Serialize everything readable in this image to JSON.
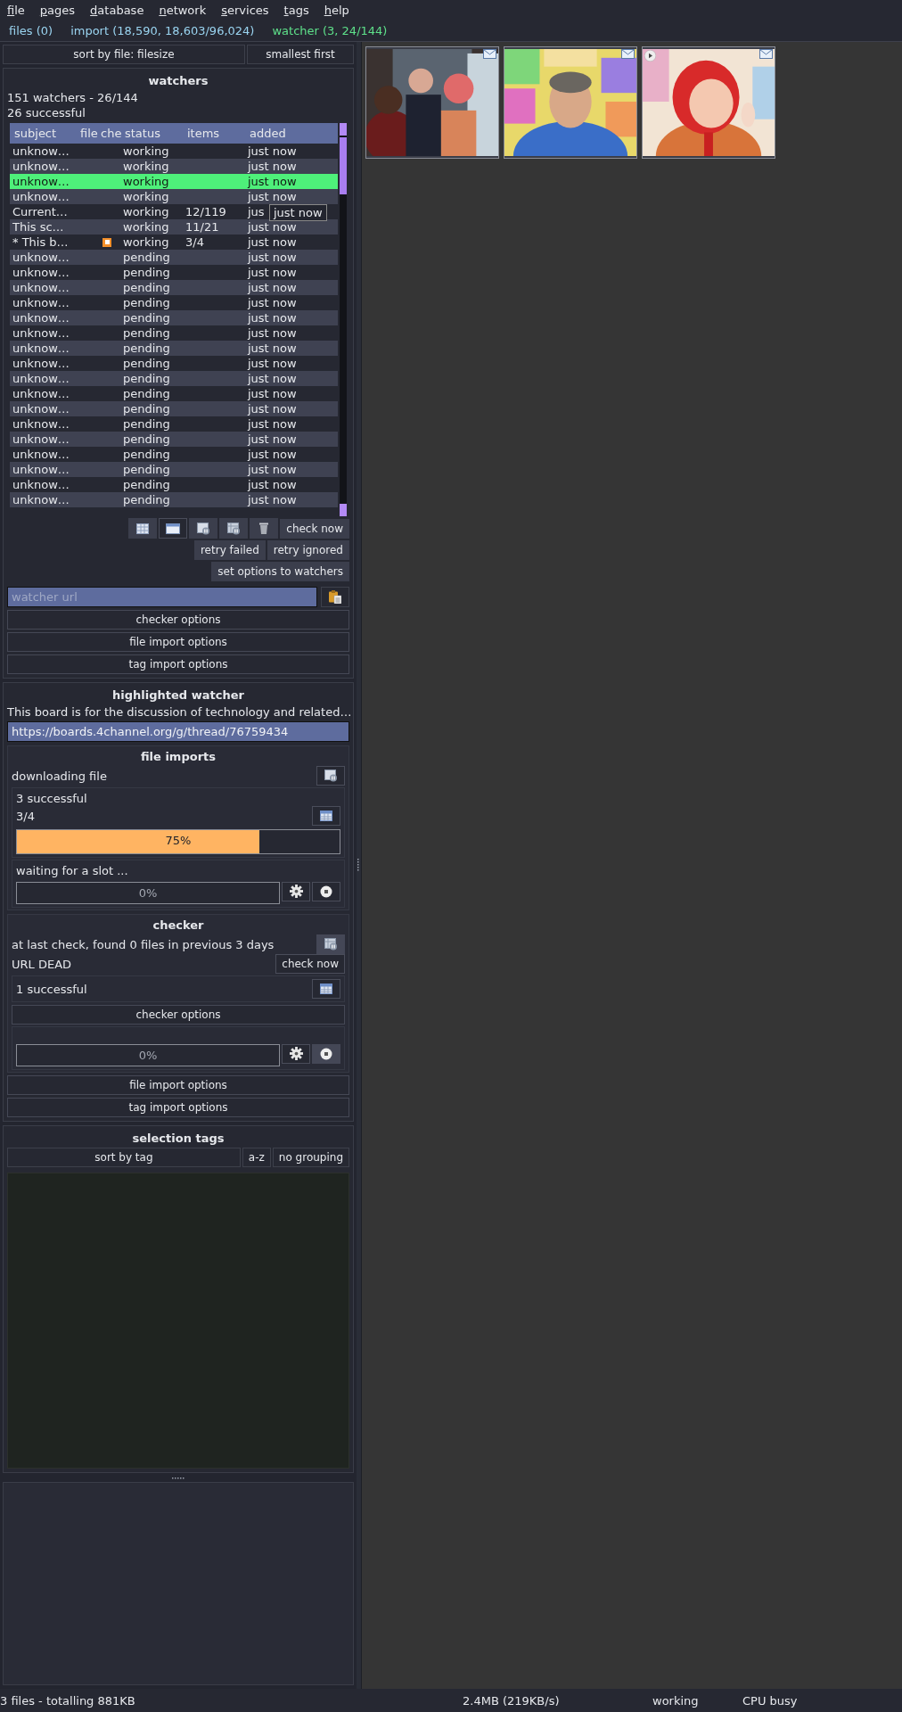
{
  "menu": [
    {
      "label": "file"
    },
    {
      "label": "pages"
    },
    {
      "label": "database"
    },
    {
      "label": "network"
    },
    {
      "label": "services"
    },
    {
      "label": "tags"
    },
    {
      "label": "help"
    }
  ],
  "page_tabs": [
    {
      "label": "files (0)",
      "selected": false
    },
    {
      "label": "import (18,590, 18,603/96,024)",
      "selected": false
    },
    {
      "label": "watcher (3, 24/144)",
      "selected": true
    }
  ],
  "sort": {
    "by": "sort by file: filesize",
    "order": "smallest first"
  },
  "watchers": {
    "title": "watchers",
    "summary": "151 watchers - 26/144",
    "successful": "26 successful",
    "columns": [
      "subject",
      "file",
      "che",
      "status",
      "items",
      "added"
    ],
    "rows": [
      {
        "subject": "unknow…",
        "checker_icon": false,
        "status": "working",
        "items": "",
        "added": "just now",
        "selected": false
      },
      {
        "subject": "unknow…",
        "checker_icon": false,
        "status": "working",
        "items": "",
        "added": "just now",
        "selected": false
      },
      {
        "subject": "unknow…",
        "checker_icon": false,
        "status": "working",
        "items": "",
        "added": "just now",
        "selected": true
      },
      {
        "subject": "unknow…",
        "checker_icon": false,
        "status": "working",
        "items": "",
        "added": "just now",
        "selected": false
      },
      {
        "subject": "Current…",
        "checker_icon": false,
        "status": "working",
        "items": "12/119",
        "added": "jus",
        "selected": false
      },
      {
        "subject": "This sc…",
        "checker_icon": false,
        "status": "working",
        "items": "11/21",
        "added": "just now",
        "selected": false
      },
      {
        "subject": "* This b…",
        "checker_icon": true,
        "status": "working",
        "items": "3/4",
        "added": "just now",
        "selected": false
      },
      {
        "subject": "unknow…",
        "checker_icon": false,
        "status": "pending",
        "items": "",
        "added": "just now",
        "selected": false
      },
      {
        "subject": "unknow…",
        "checker_icon": false,
        "status": "pending",
        "items": "",
        "added": "just now",
        "selected": false
      },
      {
        "subject": "unknow…",
        "checker_icon": false,
        "status": "pending",
        "items": "",
        "added": "just now",
        "selected": false
      },
      {
        "subject": "unknow…",
        "checker_icon": false,
        "status": "pending",
        "items": "",
        "added": "just now",
        "selected": false
      },
      {
        "subject": "unknow…",
        "checker_icon": false,
        "status": "pending",
        "items": "",
        "added": "just now",
        "selected": false
      },
      {
        "subject": "unknow…",
        "checker_icon": false,
        "status": "pending",
        "items": "",
        "added": "just now",
        "selected": false
      },
      {
        "subject": "unknow…",
        "checker_icon": false,
        "status": "pending",
        "items": "",
        "added": "just now",
        "selected": false
      },
      {
        "subject": "unknow…",
        "checker_icon": false,
        "status": "pending",
        "items": "",
        "added": "just now",
        "selected": false
      },
      {
        "subject": "unknow…",
        "checker_icon": false,
        "status": "pending",
        "items": "",
        "added": "just now",
        "selected": false
      },
      {
        "subject": "unknow…",
        "checker_icon": false,
        "status": "pending",
        "items": "",
        "added": "just now",
        "selected": false
      },
      {
        "subject": "unknow…",
        "checker_icon": false,
        "status": "pending",
        "items": "",
        "added": "just now",
        "selected": false
      },
      {
        "subject": "unknow…",
        "checker_icon": false,
        "status": "pending",
        "items": "",
        "added": "just now",
        "selected": false
      },
      {
        "subject": "unknow…",
        "checker_icon": false,
        "status": "pending",
        "items": "",
        "added": "just now",
        "selected": false
      },
      {
        "subject": "unknow…",
        "checker_icon": false,
        "status": "pending",
        "items": "",
        "added": "just now",
        "selected": false
      },
      {
        "subject": "unknow…",
        "checker_icon": false,
        "status": "pending",
        "items": "",
        "added": "just now",
        "selected": false
      },
      {
        "subject": "unknow…",
        "checker_icon": false,
        "status": "pending",
        "items": "",
        "added": "just now",
        "selected": false
      },
      {
        "subject": "unknow…",
        "checker_icon": false,
        "status": "pending",
        "items": "",
        "added": "just now",
        "selected": false
      }
    ],
    "tooltip": "just now",
    "buttons": [
      "check now",
      "retry failed",
      "retry ignored",
      "set options to watchers"
    ],
    "url_field": {
      "placeholder": "watcher url"
    },
    "options": [
      "checker options",
      "file import options",
      "tag import options"
    ]
  },
  "highlighted": {
    "title": "highlighted watcher",
    "description": "This board is for the discussion of technology and related…",
    "url": "https://boards.4channel.org/g/thread/76759434",
    "file_imports": {
      "title": "file imports",
      "status": "downloading file",
      "successful": "3 successful",
      "count": "3/4",
      "progress": {
        "level": 0.75,
        "label": "75%"
      },
      "slot": {
        "status": "waiting for a slot ...",
        "level": 0,
        "label": "0%"
      }
    },
    "checker": {
      "title": "checker",
      "last_check": "at last check, found 0 files in previous 3 days",
      "status": "URL DEAD",
      "check_button": "check now",
      "successful": "1 successful",
      "options": "checker options",
      "progress": {
        "level": 0,
        "label": "0%"
      }
    },
    "options": [
      "file import options",
      "tag import options"
    ]
  },
  "selection_tags": {
    "title": "selection tags",
    "sort": "sort by tag",
    "order": "a-z",
    "grouping": "no grouping"
  },
  "thumbnails": [
    {
      "kind": "picture",
      "video": false
    },
    {
      "kind": "picture",
      "video": false
    },
    {
      "kind": "picture",
      "video": true
    }
  ],
  "status_bar": [
    "3 files - totalling 881KB",
    "2.4MB (219KB/s)",
    "working",
    "CPU busy"
  ]
}
